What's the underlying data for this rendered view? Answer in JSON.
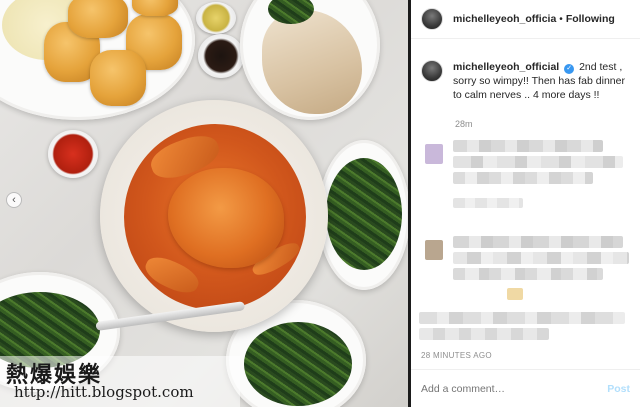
{
  "post": {
    "header": {
      "username": "michelleyeoh_officia",
      "separator": "•",
      "follow_status": "Following"
    },
    "caption": {
      "username": "michelleyeoh_official",
      "verified_badge": "verified-checkmark",
      "text": "2nd test , sorry so wimpy!! Then has fab dinner to calm nerves .. 4 more days !!",
      "time": "28m"
    },
    "timestamp": "28 MINUTES AGO",
    "comment_box": {
      "placeholder": "Add a comment…",
      "post_label": "Post"
    }
  },
  "photo": {
    "prev_icon": "chevron-left-icon",
    "prev_glyph": "‹"
  },
  "watermark": {
    "chinese": "熱爆娛樂",
    "url": "http://hitt.blogspot.com"
  },
  "colors": {
    "accent_blue": "#3897f0",
    "post_disabled": "#b2dffc",
    "meta_gray": "#8e8e8e"
  }
}
